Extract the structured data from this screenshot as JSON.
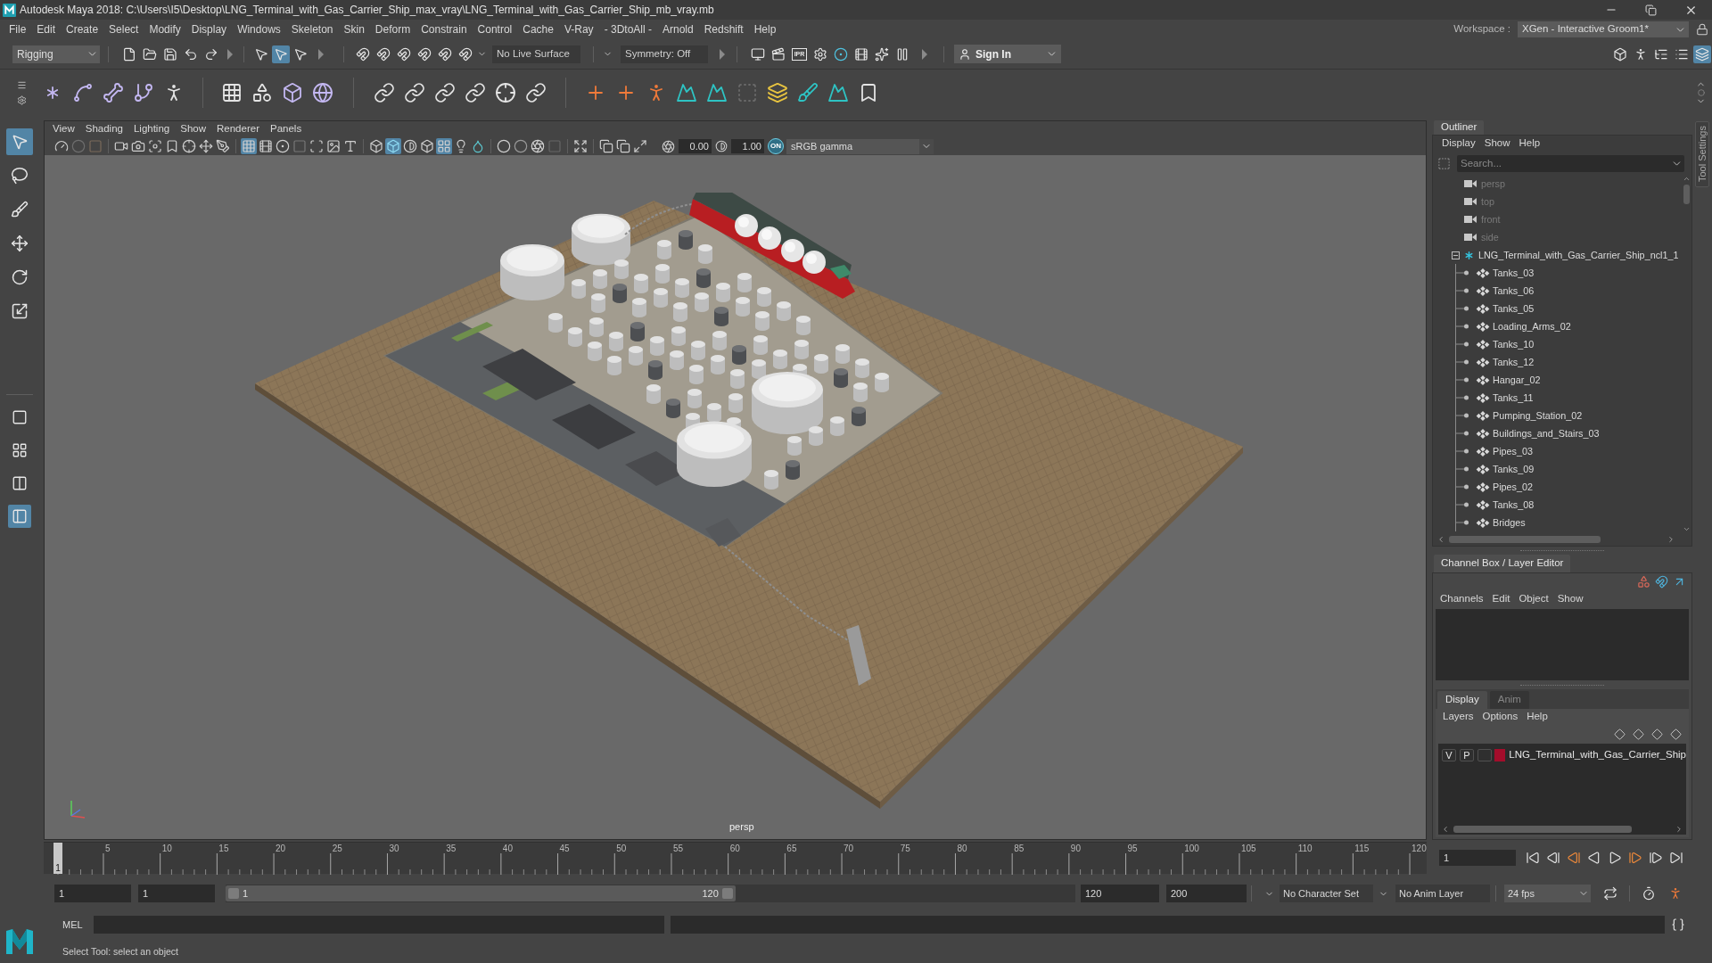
{
  "window": {
    "title": "Autodesk Maya 2018: C:\\Users\\I5\\Desktop\\LNG_Terminal_with_Gas_Carrier_Ship_max_vray\\LNG_Terminal_with_Gas_Carrier_Ship_mb_vray.mb"
  },
  "menu_bar": [
    "File",
    "Edit",
    "Create",
    "Select",
    "Modify",
    "Display",
    "Windows",
    "Skeleton",
    "Skin",
    "Deform",
    "Constrain",
    "Control",
    "Cache",
    "V-Ray",
    "- 3DtoAll -",
    "Arnold",
    "Redshift",
    "Help"
  ],
  "workspace": {
    "label": "Workspace :",
    "value": "XGen - Interactive Groom1*"
  },
  "status_line": {
    "menu_set": "Rigging",
    "selection_modes": [
      {
        "selected": false
      },
      {
        "selected": true
      },
      {
        "selected": false
      }
    ],
    "live_surface": "No Live Surface",
    "symmetry": "Symmetry: Off",
    "ipr": "IPR",
    "sign_in": "Sign In",
    "panel_toggles": [
      {
        "on": false
      },
      {
        "on": false
      },
      {
        "on": false
      },
      {
        "on": false
      },
      {
        "on": true
      }
    ]
  },
  "toolbox": {
    "tools": [
      {
        "selected": true
      },
      {
        "selected": false
      },
      {
        "selected": false
      },
      {
        "selected": false
      },
      {
        "selected": false
      },
      {
        "selected": false
      }
    ],
    "layouts": [
      {
        "selected": false
      },
      {
        "selected": false
      },
      {
        "selected": false
      },
      {
        "selected": true
      }
    ]
  },
  "viewport": {
    "menu": [
      "View",
      "Shading",
      "Lighting",
      "Show",
      "Renderer",
      "Panels"
    ],
    "toolbar": [
      {
        "on": false
      },
      {
        "on": false
      },
      {
        "on": false
      },
      {
        "on": false
      },
      {
        "on": false
      },
      {
        "on": false
      },
      {
        "on": false
      },
      {
        "on": false
      },
      {
        "on": false
      },
      {
        "on": false
      },
      {
        "on": true
      },
      {
        "on": false
      },
      {
        "on": false
      },
      {
        "on": false
      },
      {
        "on": false
      },
      {
        "on": false
      },
      {
        "on": false
      },
      {
        "on": false
      },
      {
        "on": true
      },
      {
        "on": false
      },
      {
        "on": false
      },
      {
        "on": true
      },
      {
        "on": false
      },
      {
        "on": false
      },
      {
        "on": false
      },
      {
        "on": false
      },
      {
        "on": false
      },
      {
        "on": false
      },
      {
        "on": false
      },
      {
        "on": false
      },
      {
        "on": false
      },
      {
        "on": false
      }
    ],
    "exposure": "0.00",
    "gamma": "1.00",
    "color_management": "ON",
    "color_space": "sRGB gamma",
    "camera": "persp"
  },
  "outliner": {
    "title": "Outliner",
    "menu": [
      "Display",
      "Show",
      "Help"
    ],
    "search": {
      "placeholder": "Search..."
    },
    "items": [
      {
        "kind": "camera",
        "label": "persp"
      },
      {
        "kind": "camera",
        "label": "top"
      },
      {
        "kind": "camera",
        "label": "front"
      },
      {
        "kind": "camera",
        "label": "side"
      },
      {
        "kind": "group",
        "label": "LNG_Terminal_with_Gas_Carrier_Ship_ncl1_1",
        "expanded": true,
        "children": [
          {
            "kind": "transform",
            "label": "Tanks_03"
          },
          {
            "kind": "transform",
            "label": "Tanks_06"
          },
          {
            "kind": "transform",
            "label": "Tanks_05"
          },
          {
            "kind": "transform",
            "label": "Loading_Arms_02"
          },
          {
            "kind": "transform",
            "label": "Tanks_10"
          },
          {
            "kind": "transform",
            "label": "Tanks_12"
          },
          {
            "kind": "transform",
            "label": "Hangar_02"
          },
          {
            "kind": "transform",
            "label": "Tanks_11"
          },
          {
            "kind": "transform",
            "label": "Pumping_Station_02"
          },
          {
            "kind": "transform",
            "label": "Buildings_and_Stairs_03"
          },
          {
            "kind": "transform",
            "label": "Pipes_03"
          },
          {
            "kind": "transform",
            "label": "Tanks_09"
          },
          {
            "kind": "transform",
            "label": "Pipes_02"
          },
          {
            "kind": "transform",
            "label": "Tanks_08"
          },
          {
            "kind": "transform",
            "label": "Bridges"
          }
        ]
      }
    ]
  },
  "tool_settings_tab": "Tool Settings",
  "channel_box": {
    "title": "Channel Box / Layer Editor",
    "menu": [
      "Channels",
      "Edit",
      "Object",
      "Show"
    ]
  },
  "layer_editor": {
    "tabs": [
      {
        "label": "Display",
        "selected": true
      },
      {
        "label": "Anim",
        "selected": false
      }
    ],
    "menu": [
      "Layers",
      "Options",
      "Help"
    ],
    "layers": [
      {
        "visibility": "V",
        "playback": "P",
        "color": "#a30d2b",
        "name": "LNG_Terminal_with_Gas_Carrier_Ship"
      }
    ]
  },
  "time_slider": {
    "labels": [
      "5",
      "10",
      "15",
      "20",
      "25",
      "30",
      "35",
      "40",
      "45",
      "50",
      "55",
      "60",
      "65",
      "70",
      "75",
      "80",
      "85",
      "90",
      "95",
      "100",
      "105",
      "110",
      "115",
      "120"
    ],
    "current_frame": "1",
    "level": 0,
    "frame_field": "1"
  },
  "range_slider": {
    "start": "1",
    "playback_start": "1",
    "handle_start": "1",
    "handle_end": "120",
    "level": 0.6,
    "playback_end": "120",
    "end": "200"
  },
  "character_set": "No Character Set",
  "anim_layer": "No Anim Layer",
  "fps": "24 fps",
  "command_line": {
    "language": "MEL"
  },
  "help_line": "Select Tool: select an object"
}
